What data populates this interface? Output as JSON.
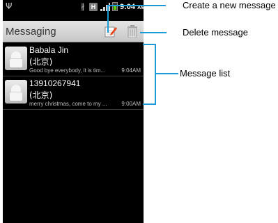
{
  "status_bar": {
    "time": "9:04",
    "ampm": "AM",
    "network_badge": "H",
    "battery_color": "#5fd000"
  },
  "header": {
    "title": "Messaging",
    "compose_icon": "compose-icon",
    "delete_icon": "trash-icon"
  },
  "messages": [
    {
      "name": "Babala Jin",
      "location": "(北京)",
      "preview": "Good bye everybody, it is tim...",
      "time": "9:04AM"
    },
    {
      "name": "13910267941",
      "location": "(北京)",
      "preview": "merry christmas, come to my ...",
      "time": "9:00AM"
    }
  ],
  "annotations": {
    "create_new_message": "Create a new message",
    "delete_message": "Delete message",
    "message_list": "Message list",
    "callout_color": "#1a9ad6"
  }
}
